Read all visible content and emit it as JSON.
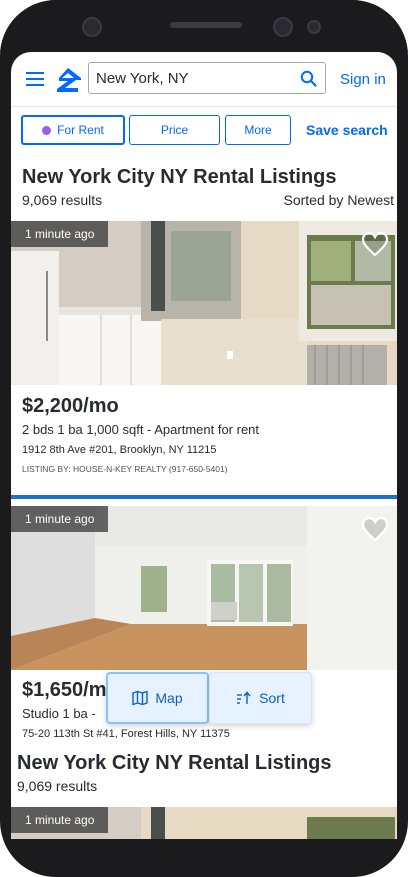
{
  "header": {
    "search_value": "New York, NY",
    "sign_in": "Sign in"
  },
  "filters": {
    "for_rent": "For Rent",
    "price": "Price",
    "more": "More",
    "save_search": "Save search"
  },
  "results_header": {
    "title": "New York City NY Rental Listings",
    "count": "9,069 results",
    "sort": "Sorted by Newest"
  },
  "listings": [
    {
      "time": "1 minute ago",
      "price": "$2,200/mo",
      "facts": "2 bds  1 ba  1,000 sqft  - Apartment for rent",
      "address": "1912 8th Ave #201, Brooklyn, NY 11215",
      "listing_by": "LISTING BY: HOUSE-N-KEY REALTY (917-650-5401)"
    },
    {
      "time": "1 minute ago",
      "price": "$1,650/m",
      "facts": "Studio  1 ba  -",
      "address": "75-20 113th St #41, Forest Hills, NY 11375"
    }
  ],
  "sticky_header": {
    "title": "New York City NY Rental Listings",
    "count": "9,069 results"
  },
  "third_listing": {
    "time": "1 minute ago"
  },
  "floating_actions": {
    "map": "Map",
    "sort": "Sort"
  },
  "colors": {
    "brand_blue": "#006aff",
    "rent_dot": "#9b5de5",
    "separator": "#1f6fd1"
  },
  "icons": [
    "menu-icon",
    "zillow-logo",
    "search-icon",
    "heart-icon",
    "map-icon",
    "sort-icon"
  ]
}
